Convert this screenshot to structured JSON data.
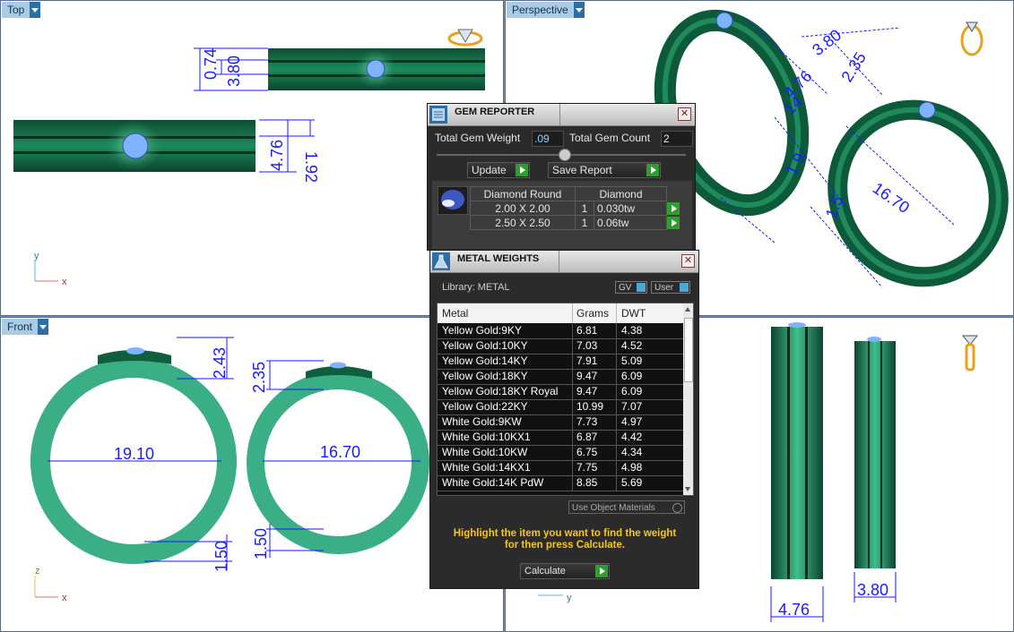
{
  "viewports": {
    "top": {
      "label": "Top"
    },
    "perspective": {
      "label": "Perspective"
    },
    "front": {
      "label": "Front"
    }
  },
  "dimensions": {
    "top_074": "0.74",
    "top_380": "3.80",
    "top_192": "1.92",
    "top_476": "4.76",
    "persp_380": "3.80",
    "persp_235": "2.35",
    "persp_476": "4.76",
    "persp_14": "14",
    "persp_19": "1.9",
    "persp_1670": "16.70",
    "persp_15": "1.5",
    "front_243": "2.43",
    "front_235": "2.35",
    "front_1910": "19.10",
    "front_1670": "16.70",
    "front_150a": "1.50",
    "front_150b": "1.50",
    "side_476": "4.76",
    "side_380": "3.80"
  },
  "axes": {
    "top": {
      "y": "y",
      "x": "x"
    },
    "front": {
      "z": "z",
      "x": "x"
    },
    "side": {
      "y": "y"
    }
  },
  "gem_reporter": {
    "title": "GEM REPORTER",
    "total_weight_label": "Total Gem Weight",
    "total_weight_value": ".09",
    "total_count_label": "Total Gem Count",
    "total_count_value": "2",
    "update_label": "Update",
    "save_label": "Save Report",
    "table": {
      "col1": "Diamond Round",
      "col2": "Diamond",
      "rows": [
        {
          "size": "2.00 X 2.00",
          "count": "1",
          "weight": "0.030tw"
        },
        {
          "size": "2.50 X 2.50",
          "count": "1",
          "weight": "0.06tw"
        }
      ]
    }
  },
  "metal_weights": {
    "title": "METAL WEIGHTS",
    "library_label": "Library: METAL",
    "gv_label": "GV",
    "user_label": "User",
    "columns": {
      "metal": "Metal",
      "grams": "Grams",
      "dwt": "DWT"
    },
    "rows": [
      {
        "metal": "Yellow Gold:9KY",
        "grams": "6.81",
        "dwt": "4.38"
      },
      {
        "metal": "Yellow Gold:10KY",
        "grams": "7.03",
        "dwt": "4.52"
      },
      {
        "metal": "Yellow Gold:14KY",
        "grams": "7.91",
        "dwt": "5.09"
      },
      {
        "metal": "Yellow Gold:18KY",
        "grams": "9.47",
        "dwt": "6.09"
      },
      {
        "metal": "Yellow Gold:18KY Royal",
        "grams": "9.47",
        "dwt": "6.09"
      },
      {
        "metal": "Yellow Gold:22KY",
        "grams": "10.99",
        "dwt": "7.07"
      },
      {
        "metal": "White Gold:9KW",
        "grams": "7.73",
        "dwt": "4.97"
      },
      {
        "metal": "White Gold:10KX1",
        "grams": "6.87",
        "dwt": "4.42"
      },
      {
        "metal": "White Gold:10KW",
        "grams": "6.75",
        "dwt": "4.34"
      },
      {
        "metal": "White Gold:14KX1",
        "grams": "7.75",
        "dwt": "4.98"
      },
      {
        "metal": "White Gold:14K PdW",
        "grams": "8.85",
        "dwt": "5.69"
      }
    ],
    "use_object_materials": "Use Object Materials",
    "hint_line1": "Highlight the item you want to find the weight",
    "hint_line2": "for then press Calculate.",
    "calculate_label": "Calculate"
  },
  "colors": {
    "ring": "#1f7a55",
    "ring_light": "#3fb88a",
    "gem": "#6fa0ff",
    "dim": "#1a1aff",
    "panel_bg": "#2b2b2b",
    "hint": "#f6c61a"
  }
}
